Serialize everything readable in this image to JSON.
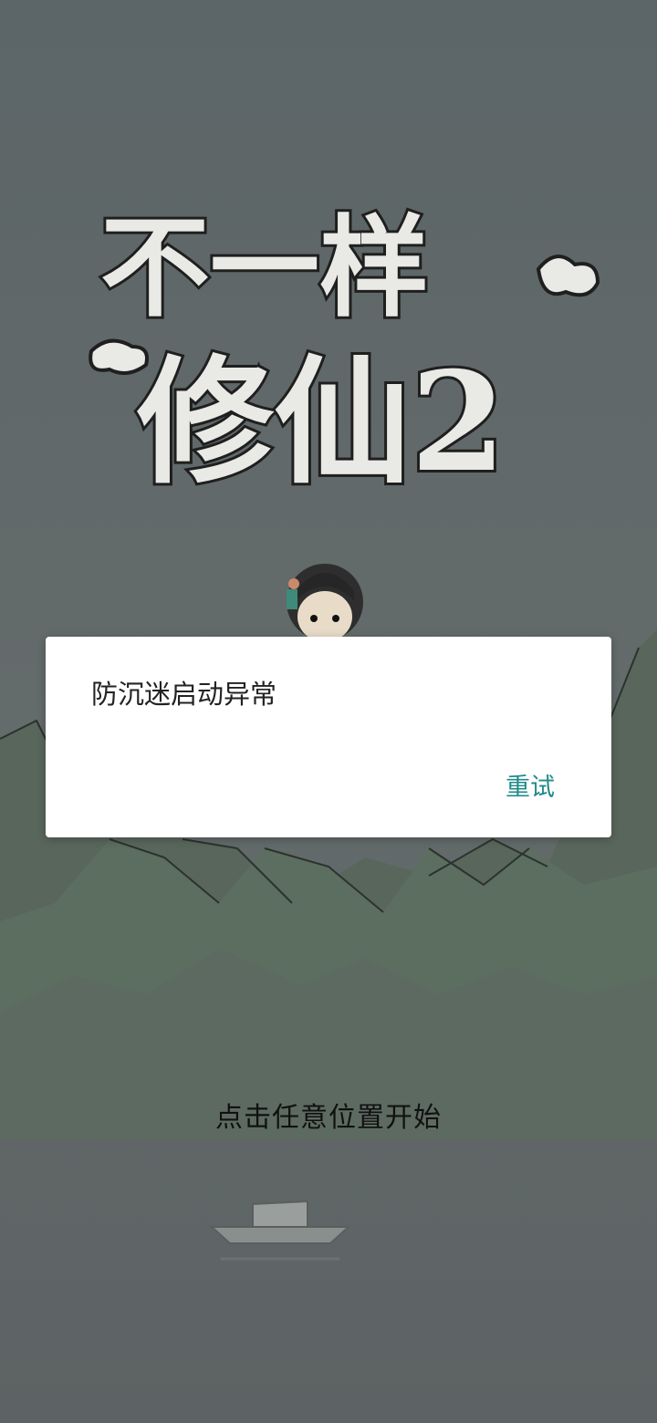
{
  "game": {
    "title_line1": "不一样",
    "title_line2": "修仙2",
    "start_hint": "点击任意位置开始"
  },
  "dialog": {
    "message": "防沉迷启动异常",
    "retry_label": "重试",
    "accent_color": "#1f8a8a"
  },
  "icons": {
    "character": "character-portrait",
    "boat": "boat-illustration"
  }
}
